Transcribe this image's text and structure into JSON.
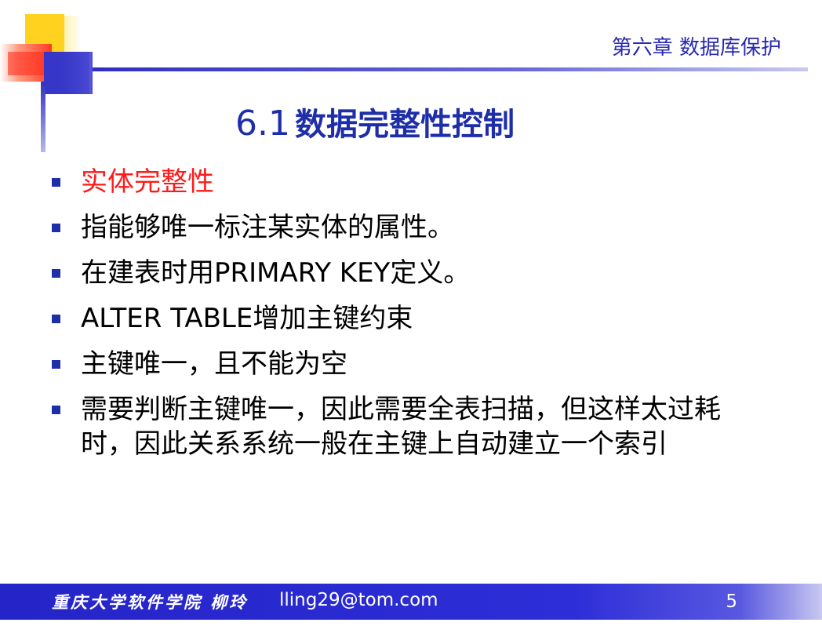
{
  "header": {
    "chapter": "第六章 数据库保护"
  },
  "title": {
    "number": "6.1",
    "text": "数据完整性控制"
  },
  "bullets": [
    {
      "text": "实体完整性",
      "highlight": true
    },
    {
      "text": "指能够唯一标注某实体的属性。",
      "highlight": false
    },
    {
      "text": "在建表时用PRIMARY KEY定义。",
      "highlight": false
    },
    {
      "text": "ALTER TABLE增加主键约束",
      "highlight": false
    },
    {
      "text": "主键唯一，且不能为空",
      "highlight": false
    },
    {
      "text": "需要判断主键唯一，因此需要全表扫描，但这样太过耗时，因此关系系统一般在主键上自动建立一个索引",
      "highlight": false
    }
  ],
  "footer": {
    "school": "重庆大学软件学院 柳玲",
    "email": "lling29@tom.com",
    "page": "5"
  },
  "colors": {
    "accent": "#1e2ea8",
    "highlight": "#ff1a1a",
    "footer_bg": "#2424c8"
  }
}
